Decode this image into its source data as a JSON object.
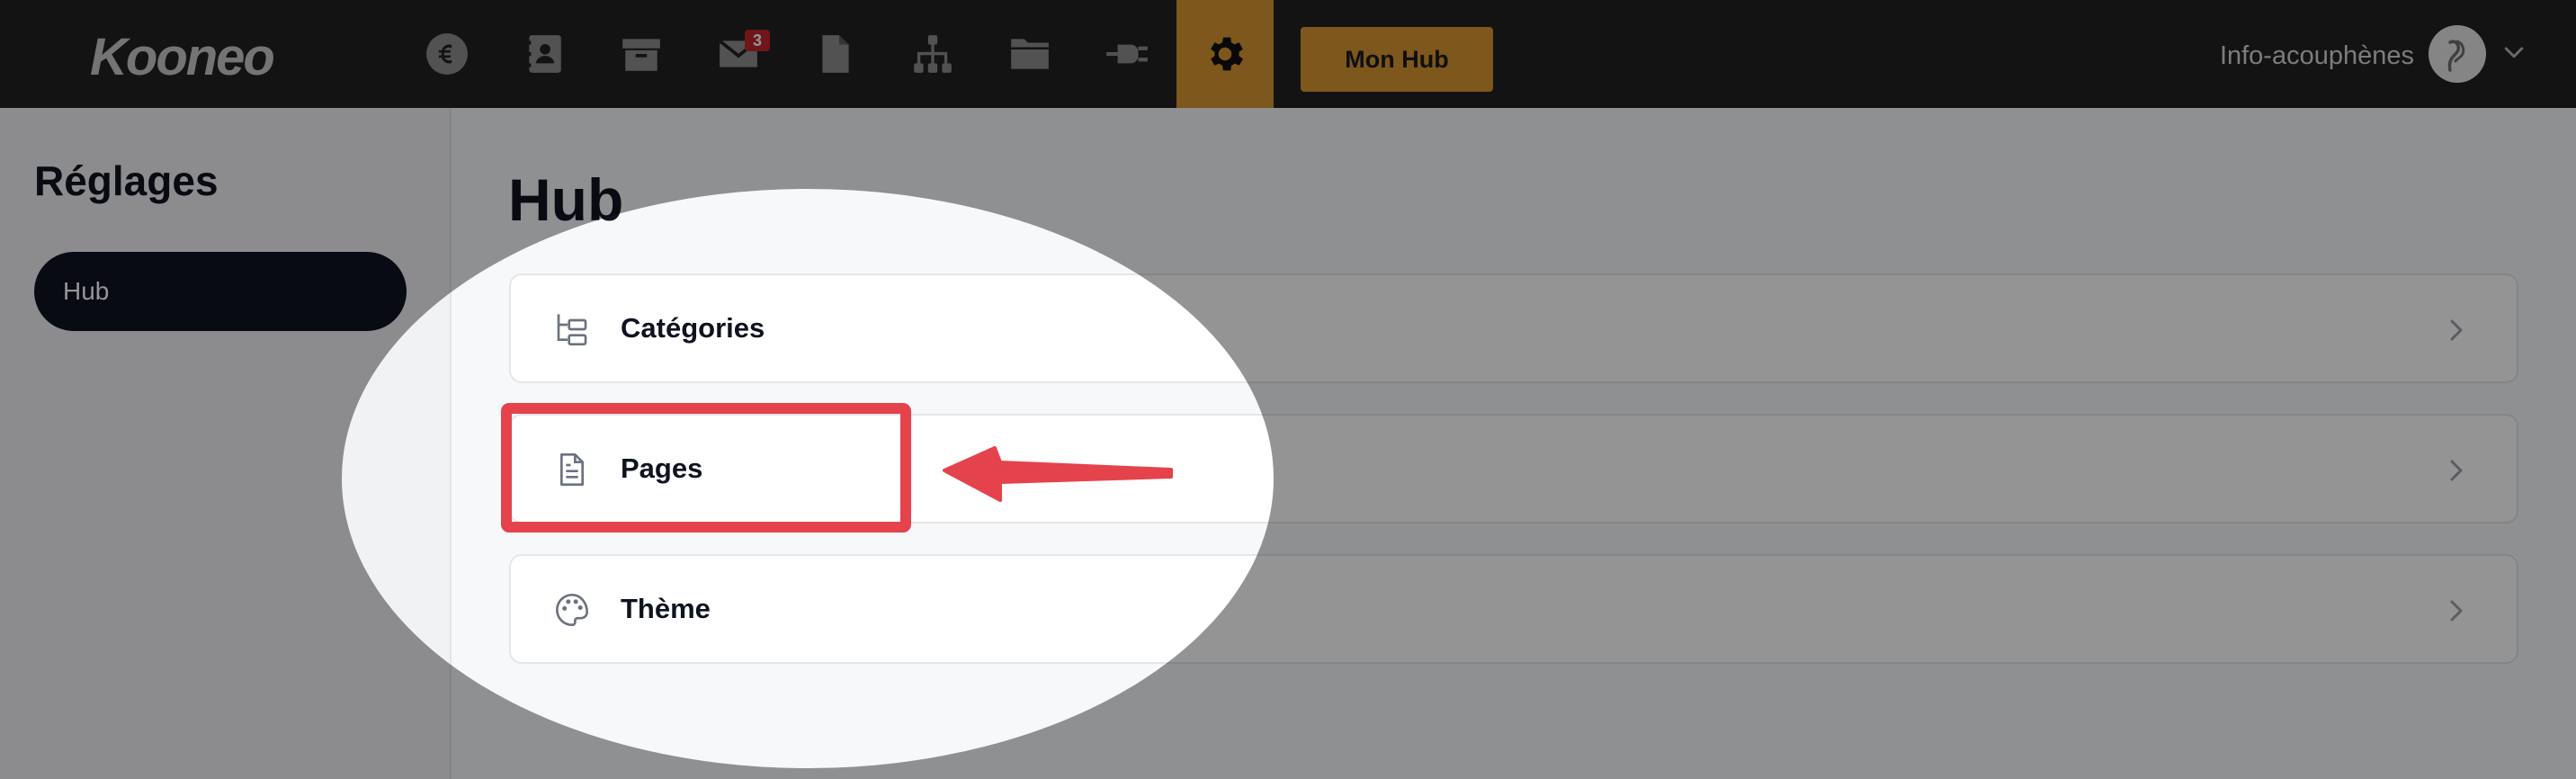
{
  "app": {
    "logo": "Kooneo"
  },
  "topbar": {
    "icons": [
      {
        "name": "euro-icon"
      },
      {
        "name": "contacts-icon"
      },
      {
        "name": "box-icon"
      },
      {
        "name": "mail-icon",
        "badge": "3"
      },
      {
        "name": "document-icon"
      },
      {
        "name": "sitemap-icon"
      },
      {
        "name": "folder-icon"
      },
      {
        "name": "plug-icon"
      },
      {
        "name": "gear-icon",
        "active": true
      }
    ],
    "mon_hub_label": "Mon Hub",
    "user_name": "Info-acouphènes"
  },
  "sidebar": {
    "title": "Réglages",
    "items": [
      {
        "label": "Hub",
        "active": true
      }
    ]
  },
  "main": {
    "title": "Hub",
    "cards": [
      {
        "label": "Catégories",
        "icon": "tree-icon"
      },
      {
        "label": "Pages",
        "icon": "file-icon"
      },
      {
        "label": "Thème",
        "icon": "palette-icon"
      }
    ]
  },
  "colors": {
    "topbar_bg": "#222222",
    "accent": "#d8962f",
    "sidebar_active": "#0e1424",
    "annotation_red": "#e4434c"
  }
}
